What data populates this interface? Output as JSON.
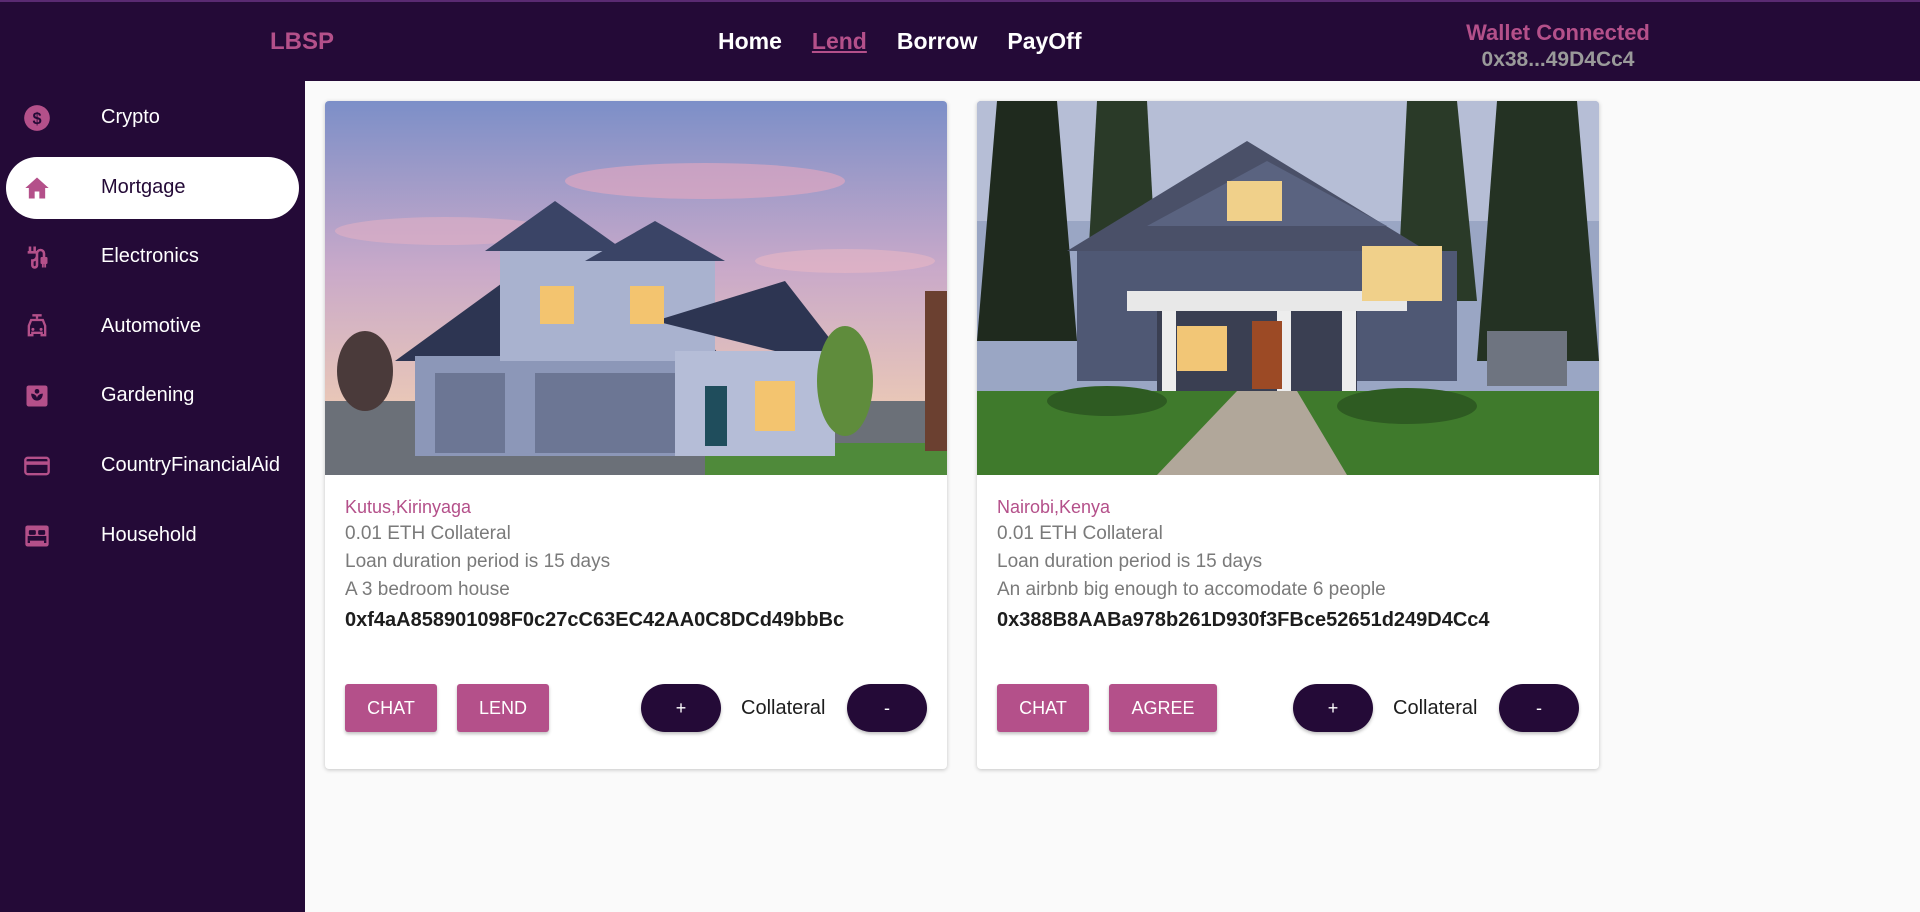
{
  "header": {
    "brand": "LBSP",
    "nav": [
      "Home",
      "Lend",
      "Borrow",
      "PayOff"
    ],
    "active_nav": "Lend",
    "wallet_status": "Wallet Connected",
    "wallet_address": "0x38...49D4Cc4"
  },
  "sidebar": {
    "items": [
      {
        "label": "Crypto",
        "icon": "dollar-circle-icon"
      },
      {
        "label": "Mortgage",
        "icon": "home-icon"
      },
      {
        "label": "Electronics",
        "icon": "cable-icon"
      },
      {
        "label": "Automotive",
        "icon": "car-icon"
      },
      {
        "label": "Gardening",
        "icon": "garden-icon"
      },
      {
        "label": "CountryFinancialAid",
        "icon": "credit-card-icon"
      },
      {
        "label": "Household",
        "icon": "bed-icon"
      }
    ],
    "active": "Mortgage"
  },
  "cards": [
    {
      "location": "Kutus,Kirinyaga",
      "collateral": "0.01 ETH Collateral",
      "duration": "Loan duration period is 15 days",
      "description": "A 3 bedroom house",
      "address": "0xf4aA858901098F0c27cC63EC42AA0C8DCd49bbBc",
      "btn_chat": "CHAT",
      "btn_action": "LEND",
      "plus": "+",
      "minus": "-",
      "collateral_label": "Collateral"
    },
    {
      "location": "Nairobi,Kenya",
      "collateral": "0.01 ETH Collateral",
      "duration": "Loan duration period is 15 days",
      "description": "An airbnb big enough to accomodate 6 people",
      "address": "0x388B8AABa978b261D930f3FBce52651d249D4Cc4",
      "btn_chat": "CHAT",
      "btn_action": "AGREE",
      "plus": "+",
      "minus": "-",
      "collateral_label": "Collateral"
    }
  ],
  "colors": {
    "brand": "#b4508a",
    "dark": "#240a37"
  }
}
